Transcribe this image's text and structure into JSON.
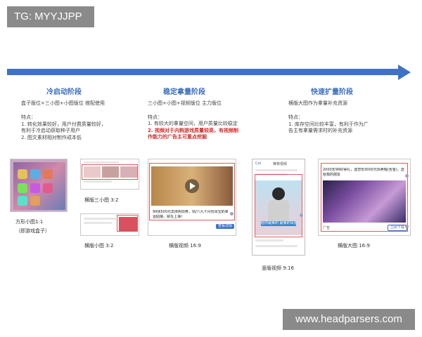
{
  "tag": "TG: MYYJJPP",
  "watermark": "www.headparsers.com",
  "stages": [
    {
      "title": "冷启动阶段",
      "subtitle": "盒子版位+三小图+小图版位 搭配使用",
      "points_label": "特点：",
      "points": [
        "1.  转化效果较好，用户付费质量较好，",
        "     有利于冷启动获取种子用户",
        "2.  图文素材相对制作成本低"
      ]
    },
    {
      "title": "稳定拿量阶段",
      "subtitle": "三小图+小图+视频版位 主力版位",
      "points_label": "特点：",
      "points": [
        "1.  有较大的拿量空间，用户质量比较稳定",
        "2.  视频对于内购游戏质量较高，有视频制",
        "     作能力的广告主可重点挖掘"
      ]
    },
    {
      "title": "快速扩量阶段",
      "subtitle": "横版大图作为拿量补充资源",
      "points_label": "特点：",
      "points": [
        "1.  库存空间比较丰富，有利于作为广",
        "     告主有拿量需求时的补充资源"
      ]
    }
  ],
  "ad_formats": [
    {
      "caption": "方形小图1:1",
      "note": "（即游戏盒子）"
    },
    {
      "caption": "横版三小图 3:2"
    },
    {
      "caption": "横版小图 3:2"
    },
    {
      "caption": "横版视频 16:9"
    },
    {
      "caption": "竖版视频 9:16"
    },
    {
      "caption": "横版大图 16:9"
    }
  ],
  "mockups": {
    "video_ad_text": "99快500元去侠购扣券，领/八九十月份出宝的幸运姑娘，就在上海！",
    "big_image_ad_text": "2000年99好得礼，送您份3000元现卖喔(含金)，送给我的朋友",
    "phone_header_left": "Cal",
    "phone_header_center": "推荐视频",
    "phone_caption_text": "给你最美的 最美的出游",
    "big_image_button": "立即下载",
    "video_button": "查看详情",
    "big_image_source": "广告"
  },
  "colors": {
    "arrow": "#3f71c4",
    "title": "#3d6fbf",
    "highlight": "#d32a2a"
  },
  "icons": [
    "play-icon",
    "arrow-right-icon"
  ]
}
